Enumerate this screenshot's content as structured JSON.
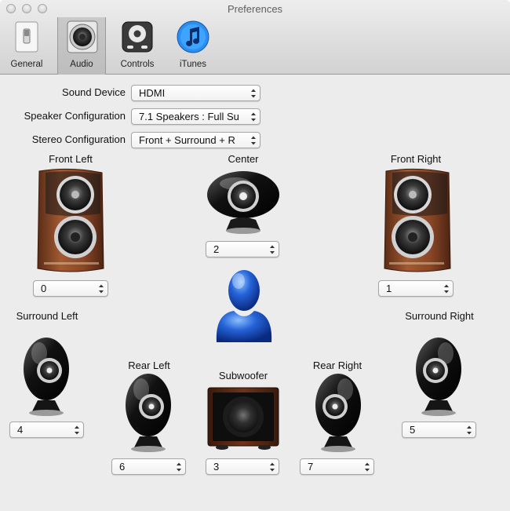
{
  "window": {
    "title": "Preferences"
  },
  "toolbar": {
    "tabs": [
      {
        "label": "General",
        "icon": "switch-icon"
      },
      {
        "label": "Audio",
        "icon": "speaker-icon",
        "selected": true
      },
      {
        "label": "Controls",
        "icon": "remote-icon"
      },
      {
        "label": "iTunes",
        "icon": "music-note-icon"
      }
    ]
  },
  "form": {
    "sound_device": {
      "label": "Sound Device",
      "value": "HDMI"
    },
    "speaker_configuration": {
      "label": "Speaker Configuration",
      "value": "7.1 Speakers : Full Su"
    },
    "stereo_configuration": {
      "label": "Stereo Configuration",
      "value": "Front + Surround + R"
    }
  },
  "speakers": {
    "front_left": {
      "label": "Front Left",
      "channel": "0"
    },
    "center": {
      "label": "Center",
      "channel": "2"
    },
    "front_right": {
      "label": "Front Right",
      "channel": "1"
    },
    "surround_left": {
      "label": "Surround Left",
      "channel": "4"
    },
    "surround_right": {
      "label": "Surround Right",
      "channel": "5"
    },
    "rear_left": {
      "label": "Rear Left",
      "channel": "6"
    },
    "subwoofer": {
      "label": "Subwoofer",
      "channel": "3"
    },
    "rear_right": {
      "label": "Rear Right",
      "channel": "7"
    }
  },
  "colors": {
    "listener": "#1e5fd6",
    "wood": "#8a4a2a",
    "speaker_black": "#151515"
  }
}
